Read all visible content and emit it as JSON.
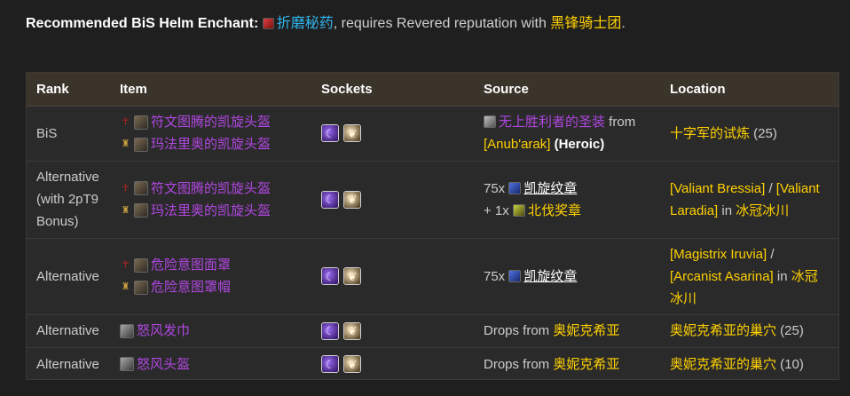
{
  "intro": {
    "label": "Recommended BiS Helm Enchant",
    "colon": ":",
    "enchant_name": "折磨秘药",
    "mid_text": ", requires Revered reputation with ",
    "faction_name": "黑锋骑士团",
    "end_text": "."
  },
  "table": {
    "headers": {
      "rank": "Rank",
      "item": "Item",
      "sockets": "Sockets",
      "source": "Source",
      "location": "Location"
    },
    "rows": [
      {
        "rank": "BiS",
        "item_horde": "符文图腾的凯旋头盔",
        "item_alliance": "玛法里奥的凯旋头盔",
        "source_item": "无上胜利者的圣装",
        "source_from": " from",
        "source_boss": "[Anub'arak]",
        "source_mode": " (Heroic)",
        "location_zone": "十字军的试炼",
        "location_size": " (25)"
      },
      {
        "rank": "Alternative (with 2pT9 Bonus)",
        "item_horde": "符文图腾的凯旋头盔",
        "item_alliance": "玛法里奥的凯旋头盔",
        "cost1_qty": "75x ",
        "cost1_name": "凯旋纹章",
        "cost2_qty": "+ 1x ",
        "cost2_name": "北伐奖章",
        "vendor1": "[Valiant Bressia]",
        "sep": " / ",
        "vendor2": "[Valiant Laradia]",
        "in_text": " in ",
        "location_zone": "冰冠冰川"
      },
      {
        "rank": "Alternative",
        "item_horde": "危险意图面罩",
        "item_alliance": "危险意图罩帽",
        "cost1_qty": "75x ",
        "cost1_name": "凯旋纹章",
        "vendor1": "[Magistrix Iruvia]",
        "sep": " /",
        "vendor2": "[Arcanist Asarina]",
        "in_text": " in ",
        "location_zone": "冰冠冰川"
      },
      {
        "rank": "Alternative",
        "item": "怒风发巾",
        "drops_text": "Drops from ",
        "boss": "奥妮克希亚",
        "location_zone": "奥妮克希亚的巢穴",
        "location_size": " (25)"
      },
      {
        "rank": "Alternative",
        "item": "怒风头盔",
        "drops_text": "Drops from ",
        "boss": "奥妮克希亚",
        "location_zone": "奥妮克希亚的巢穴",
        "location_size": " (10)"
      }
    ]
  },
  "icons": {
    "enchant": "enchant-icon",
    "horde": "horde-icon",
    "alliance": "alliance-icon",
    "meta_gem": "meta-socket-icon",
    "prismatic_gem": "prismatic-socket-icon",
    "tier_token": "tier-token-icon",
    "triumph_emblem": "emblem-of-triumph-icon",
    "crusade_commendation": "crusade-commendation-icon"
  },
  "colors": {
    "background": "#201f1f",
    "header_bg": "#3a342b",
    "link_blue": "#2fb5ee",
    "gold": "#ffd100",
    "epic_purple": "#b047e0"
  }
}
